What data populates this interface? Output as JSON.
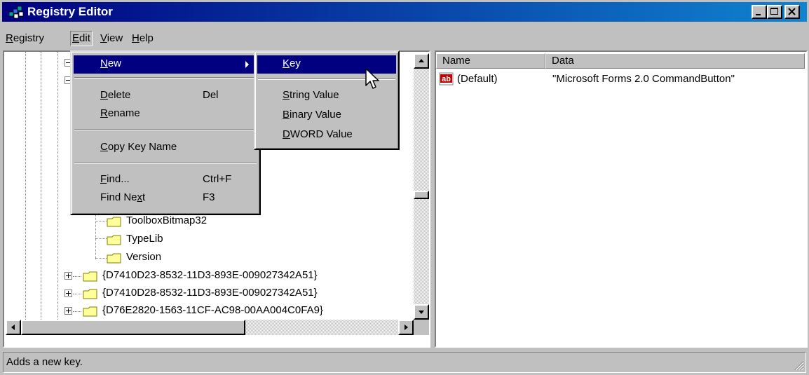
{
  "window": {
    "title": "Registry Editor",
    "title_bar_color": "#000080",
    "buttons": [
      "minimize",
      "maximize",
      "close"
    ]
  },
  "menubar": {
    "items": [
      {
        "label": "Registry",
        "mnemonic": "R"
      },
      {
        "label": "Edit",
        "mnemonic": "E",
        "open": true
      },
      {
        "label": "View",
        "mnemonic": "V"
      },
      {
        "label": "Help",
        "mnemonic": "H"
      }
    ]
  },
  "edit_menu": {
    "new": {
      "label": "New",
      "mnemonic": "N",
      "has_submenu": true
    },
    "delete": {
      "label": "Delete",
      "mnemonic": "D",
      "shortcut": "Del"
    },
    "rename": {
      "label": "Rename",
      "mnemonic": "R"
    },
    "copy_key_name": {
      "label": "Copy Key Name",
      "mnemonic": "C"
    },
    "find": {
      "label": "Find...",
      "mnemonic": "F",
      "shortcut": "Ctrl+F"
    },
    "find_next": {
      "label": "Find Next",
      "mnemonic": "x",
      "shortcut": "F3"
    }
  },
  "new_submenu": {
    "key": {
      "label": "Key",
      "mnemonic": "K"
    },
    "string_value": {
      "label": "String Value",
      "mnemonic": "S"
    },
    "binary_value": {
      "label": "Binary Value",
      "mnemonic": "B"
    },
    "dword_value": {
      "label": "DWORD Value",
      "mnemonic": "D"
    }
  },
  "tree": {
    "visible_items": [
      {
        "label": "ToolboxBitmap32",
        "expander": "none"
      },
      {
        "label": "TypeLib",
        "expander": "none"
      },
      {
        "label": "Version",
        "expander": "none"
      },
      {
        "label": "{D7410D23-8532-11D3-893E-009027342A51}",
        "expander": "plus"
      },
      {
        "label": "{D7410D28-8532-11D3-893E-009027342A51}",
        "expander": "plus"
      },
      {
        "label": "{D76E2820-1563-11CF-AC98-00AA004C0FA9}",
        "expander": "plus"
      }
    ]
  },
  "list": {
    "columns": [
      "Name",
      "Data"
    ],
    "rows": [
      {
        "icon": "string-value-icon",
        "name": "(Default)",
        "data": "\"Microsoft Forms 2.0 CommandButton\""
      }
    ]
  },
  "statusbar": {
    "text": "Adds a new key."
  }
}
